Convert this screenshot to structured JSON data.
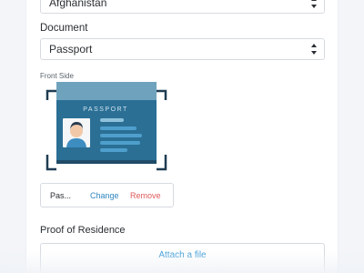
{
  "country_select": {
    "value": "Afghanistan"
  },
  "document": {
    "label": "Document",
    "select_value": "Passport"
  },
  "front_side": {
    "label": "Front Side",
    "passport_title": "PASSPORT",
    "colors": {
      "cover_header": "#6fa3bd",
      "cover_body": "#2b6f95",
      "corner_brackets": "#1f3d52"
    }
  },
  "uploaded_file": {
    "name": "Pas...",
    "change_label": "Change",
    "remove_label": "Remove"
  },
  "proof_of_residence": {
    "label": "Proof of Residence",
    "attach_label": "Attach a file"
  },
  "colors": {
    "link": "#2e86c1",
    "danger": "#e05a5a",
    "border": "#d6dbe1"
  }
}
